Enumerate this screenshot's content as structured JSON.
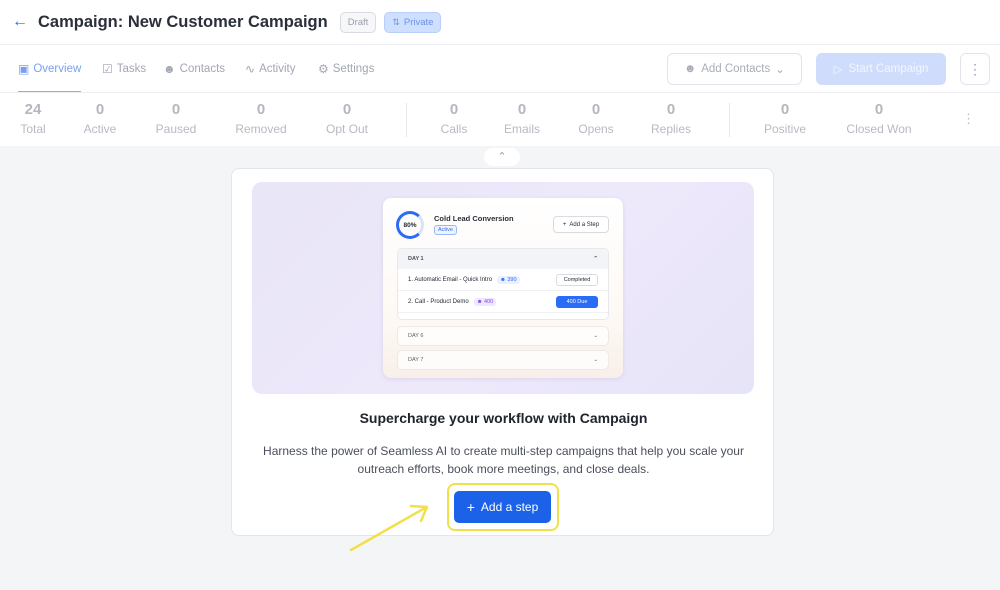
{
  "header": {
    "back_icon": "arrow-left-icon",
    "title": "Campaign: New Customer Campaign",
    "status_badge": "Draft",
    "visibility_badge": "Private"
  },
  "tabs": [
    {
      "label": "Overview",
      "icon": "monitor-icon",
      "active": true
    },
    {
      "label": "Tasks",
      "icon": "checkbox-icon",
      "active": false
    },
    {
      "label": "Contacts",
      "icon": "contacts-icon",
      "active": false
    },
    {
      "label": "Activity",
      "icon": "activity-icon",
      "active": false
    },
    {
      "label": "Settings",
      "icon": "gear-icon",
      "active": false
    }
  ],
  "actions": {
    "add_contacts": "Add Contacts",
    "start_campaign": "Start Campaign"
  },
  "stats": [
    {
      "value": "24",
      "label": "Total"
    },
    {
      "value": "0",
      "label": "Active"
    },
    {
      "value": "0",
      "label": "Paused"
    },
    {
      "value": "0",
      "label": "Removed"
    },
    {
      "value": "0",
      "label": "Opt Out"
    },
    {
      "value": "0",
      "label": "Calls"
    },
    {
      "value": "0",
      "label": "Emails"
    },
    {
      "value": "0",
      "label": "Opens"
    },
    {
      "value": "0",
      "label": "Replies"
    },
    {
      "value": "0",
      "label": "Positive"
    },
    {
      "value": "0",
      "label": "Closed Won"
    }
  ],
  "illustration": {
    "progress": "80%",
    "campaign_name": "Cold Lead Conversion",
    "campaign_status": "Active",
    "add_step": "Add a Step",
    "day1": "DAY 1",
    "step1": {
      "name": "1. Automatic Email - Quick Intro",
      "count": "390",
      "action": "Completed"
    },
    "step2": {
      "name": "2. Call - Product Demo",
      "count": "400",
      "action": "400 Due"
    },
    "day6": "DAY 6",
    "day7": "DAY 7"
  },
  "empty_state": {
    "headline": "Supercharge your workflow with Campaign",
    "description": "Harness the power of Seamless AI to create multi-step campaigns that help you scale your outreach efforts, book more meetings, and close deals.",
    "cta": "Add a step"
  },
  "colors": {
    "primary": "#1c62e8",
    "highlight": "#f1e04a"
  }
}
